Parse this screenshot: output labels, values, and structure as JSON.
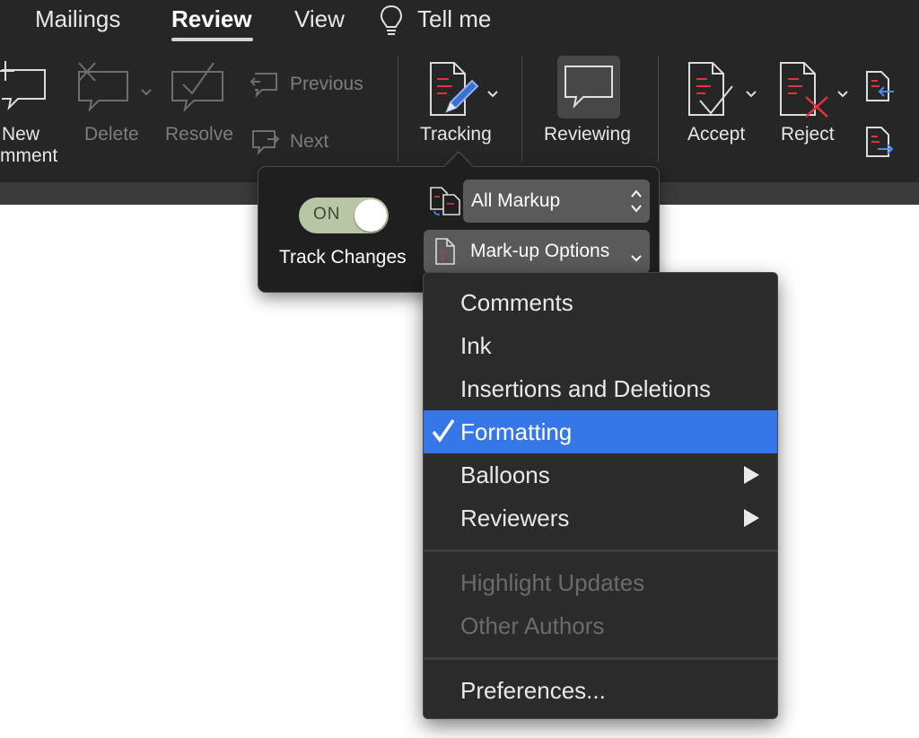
{
  "ribbon": {
    "tabs": [
      {
        "label": "Mailings"
      },
      {
        "label": "Review",
        "active": true
      },
      {
        "label": "View"
      },
      {
        "label": "Tell me",
        "icon": "lightbulb-icon"
      }
    ],
    "buttons": {
      "new_comment": {
        "line1": "New",
        "line2": "mment",
        "icon": "new-comment-icon"
      },
      "delete": {
        "label": "Delete",
        "icon": "delete-comment-icon",
        "enabled": false
      },
      "resolve": {
        "label": "Resolve",
        "icon": "resolve-comment-icon",
        "enabled": false
      },
      "previous": {
        "label": "Previous",
        "icon": "previous-comment-icon",
        "enabled": false
      },
      "next": {
        "label": "Next",
        "icon": "next-comment-icon",
        "enabled": false
      },
      "tracking": {
        "label": "Tracking",
        "icon": "tracking-pencil-icon"
      },
      "reviewing": {
        "label": "Reviewing",
        "icon": "reviewing-pane-icon",
        "pressed": true
      },
      "accept": {
        "label": "Accept",
        "icon": "accept-change-icon"
      },
      "reject": {
        "label": "Reject",
        "icon": "reject-change-icon"
      },
      "previous_change": {
        "icon": "previous-change-icon"
      },
      "next_change": {
        "icon": "next-change-icon"
      }
    }
  },
  "tracking_popover": {
    "toggle": {
      "state_text": "ON",
      "on": true
    },
    "track_changes_label": "Track Changes",
    "display_select": {
      "value": "All Markup",
      "icon": "display-for-review-icon"
    },
    "markup_options": {
      "label": "Mark-up Options",
      "icon": "markup-document-icon"
    }
  },
  "markup_menu": {
    "items": [
      {
        "label": "Comments"
      },
      {
        "label": "Ink"
      },
      {
        "label": "Insertions and Deletions"
      },
      {
        "label": "Formatting",
        "checked": true,
        "highlighted": true
      },
      {
        "label": "Balloons",
        "submenu": true
      },
      {
        "label": "Reviewers",
        "submenu": true
      }
    ],
    "disabled_items": [
      {
        "label": "Highlight Updates"
      },
      {
        "label": "Other Authors"
      }
    ],
    "footer_items": [
      {
        "label": "Preferences..."
      }
    ]
  },
  "colors": {
    "ribbon_bg": "#262626",
    "menu_bg": "#2b2b2b",
    "selection": "#3677e8",
    "toggle_on": "#b8c6a6",
    "accent_red": "#e0343a",
    "accent_blue": "#4a8cf0"
  }
}
